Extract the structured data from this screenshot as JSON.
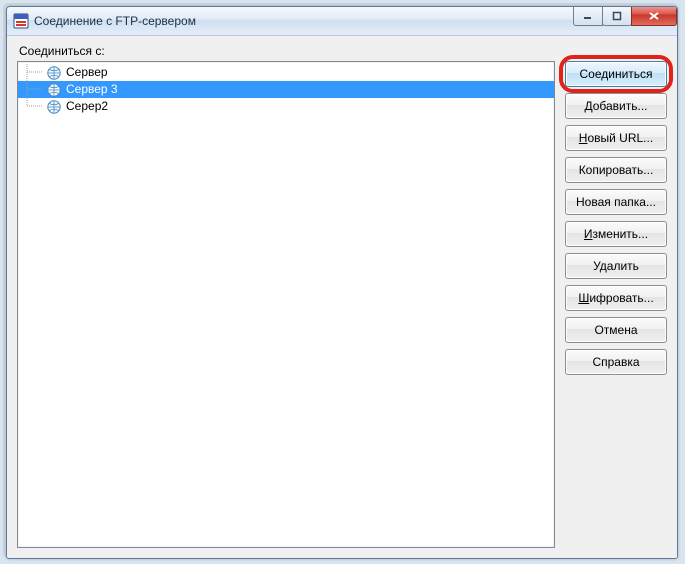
{
  "window": {
    "title": "Соединение с FTP-сервером"
  },
  "label": "Соединиться с:",
  "tree": {
    "items": [
      {
        "name": "Сервер",
        "selected": false,
        "order": 0
      },
      {
        "name": "Сервер 3",
        "selected": true,
        "order": 1
      },
      {
        "name": "Серер2",
        "selected": false,
        "order": 2
      }
    ]
  },
  "buttons": {
    "connect": "Соединиться",
    "add": "Добавить...",
    "newurl_pre": "Н",
    "newurl_post": "овый URL...",
    "copy": "Копировать...",
    "newfolder": "Новая папка...",
    "edit_pre": "И",
    "edit_post": "зменить...",
    "delete": "Удалить",
    "encrypt_pre": "Ш",
    "encrypt_post": "ифровать...",
    "cancel": "Отмена",
    "help": "Справка"
  },
  "highlight": {
    "button": "connect"
  }
}
